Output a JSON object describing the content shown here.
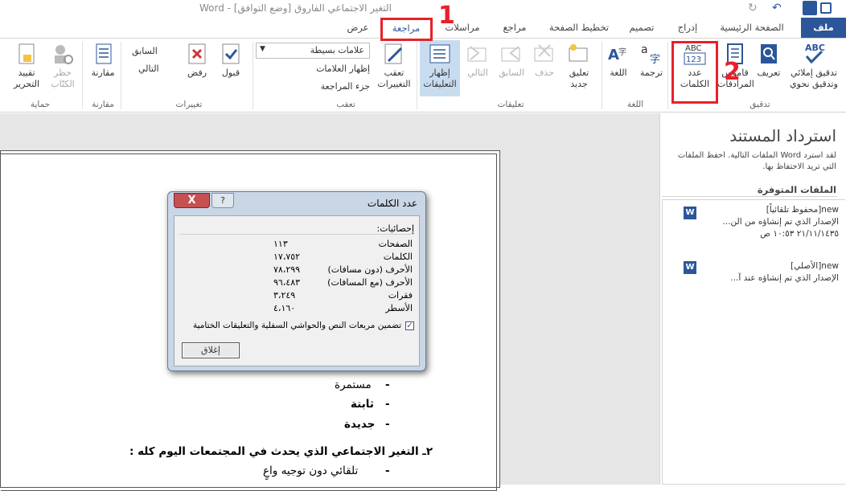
{
  "window": {
    "title": "التغير الاجتماعي الفاروق [وضع التوافق] - Word"
  },
  "tabs": [
    "ملف",
    "الصفحة الرئيسية",
    "إدراج",
    "تصميم",
    "تخطيط الصفحة",
    "مراجع",
    "مراسلات",
    "مراجعة",
    "عرض"
  ],
  "ribbon": {
    "proofing": {
      "spell": "تدقيق إملائي\nوتدقيق نحوي",
      "define": "تعريف",
      "thesaurus": "قاموس\nالمرادفات",
      "wordcount": "عدد\nالكلمات",
      "group": "تدقيق",
      "abc_label": "ABC",
      "num_label": "123"
    },
    "language": {
      "translate": "ترجمة",
      "language": "اللغة",
      "group": "اللغة"
    },
    "comments": {
      "new": "تعليق\nجديد",
      "delete": "حذف",
      "prev": "السابق",
      "next": "التالي",
      "show": "إظهار\nالتعليقات",
      "group": "تعليقات"
    },
    "tracking": {
      "track": "تعقب\nالتغييرات",
      "markup": "علامات بسيطة",
      "show_markup": "إظهار العلامات",
      "pane": "جزء المراجعة",
      "group": "تعقب"
    },
    "changes": {
      "accept": "قبول",
      "reject": "رفض",
      "prev": "السابق",
      "next": "التالي",
      "group": "تغييرات"
    },
    "compare": {
      "compare": "مقارنة",
      "group": "مقارنة"
    },
    "protect": {
      "block": "حظر\nالكتّاب",
      "restrict": "تقييد\nالتحرير",
      "group": "حماية"
    }
  },
  "annotations": {
    "n1": "1",
    "n2": "2"
  },
  "document": {
    "line1": "مستمرة",
    "line2": "ثابتة",
    "line3": "جديدة",
    "line4": "٢ـ التغير الاجتماعي الذي يحدث في المجتمعات اليوم كله :",
    "line5": "تلقائي دون توجيه واعٍ",
    "bullet": "-"
  },
  "pane": {
    "title": "استرداد المستند",
    "desc": "لقد استرد Word الملفات التالية. احفظ الملفات التي تريد الاحتفاظ بها.",
    "heading": "الملفات المتوفرة",
    "files": [
      {
        "name": "new[محفوظ تلقائياً]",
        "line2": "الإصدار الذي تم إنشاؤه من الن...",
        "line3": "٢١/١١/١٤٣٥ ١٠:٥٣ ص"
      },
      {
        "name": "new[الأصلي]",
        "line2": "الإصدار الذي تم إنشاؤه عند آ..."
      }
    ]
  },
  "dialog": {
    "title": "عدد الكلمات",
    "stats_label": "إحصائيات:",
    "rows": [
      {
        "label": "الصفحات",
        "value": "١١٣"
      },
      {
        "label": "الكلمات",
        "value": "١٧،٧٥٢"
      },
      {
        "label": "الأحرف (دون مسافات)",
        "value": "٧٨،٢٩٩"
      },
      {
        "label": "الأحرف (مع المسافات)",
        "value": "٩٦،٤٨٣"
      },
      {
        "label": "فقرات",
        "value": "٣،٢٤٩"
      },
      {
        "label": "الأسطر",
        "value": "٤،١٦٠"
      }
    ],
    "checkbox_label": "تضمين مربعات النص والحواشي السفلية والتعليقات الختامية",
    "checkbox_checked": true,
    "close_button": "إغلاق",
    "close_x": "X",
    "help": "?"
  }
}
